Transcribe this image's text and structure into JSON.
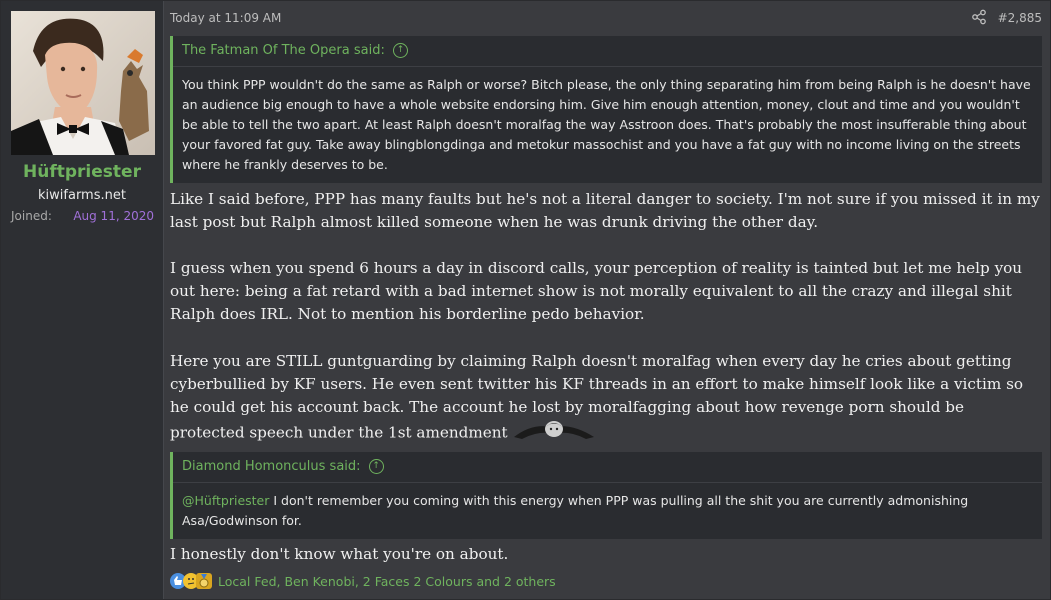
{
  "user": {
    "name": "Hüftpriester",
    "title": "kiwifarms.net",
    "joined_label": "Joined:",
    "joined_value": "Aug 11, 2020"
  },
  "post": {
    "timestamp": "Today at 11:09 AM",
    "number": "#2,885",
    "quote1": {
      "author": "The Fatman Of The Opera said:",
      "text": "You think PPP wouldn't do the same as Ralph or worse? Bitch please, the only thing separating him from being Ralph is he doesn't have an audience big enough to have a whole website endorsing him. Give him enough attention, money, clout and time and you wouldn't be able to tell the two apart. At least Ralph doesn't moralfag the way Asstroon does. That's probably the most insufferable thing about your favored fat guy. Take away blingblongdinga and metokur massochist and you have a fat guy with no income living on the streets where he frankly deserves to be."
    },
    "paragraph1": "Like I said before, PPP has many faults but he's not a literal danger to society. I'm not sure if you missed it in my last post but Ralph almost killed someone when he was drunk driving the other day.",
    "paragraph2": "I guess when you spend 6 hours a day in discord calls, your perception of reality is tainted but let me help you out here: being a fat retard with a bad internet show is not morally equivalent to all the crazy and illegal shit Ralph does IRL. Not to mention his borderline pedo behavior.",
    "paragraph3": "Here you are STILL guntguarding by claiming Ralph doesn't moralfag when every day he cries about getting cyberbullied by KF users. He even sent twitter his KF threads in an effort to make himself look like a victim so he could get his account back. The account he lost by moralfagging about how revenge porn should be protected speech under the 1st amendment",
    "quote2": {
      "author": "Diamond Homonculus said:",
      "mention": "@Hüftpriester",
      "text": " I don't remember you coming with this energy when PPP was pulling all the shit you are currently admonishing Asa/Godwinson for."
    },
    "paragraph4": "I honestly don't know what you're on about.",
    "reactions_text": "Local Fed, Ben Kenobi, 2 Faces 2 Colours and 2 others"
  },
  "icons": {
    "share": "share-icon",
    "quote_jump": "arrow-up-circle-icon",
    "reactions": [
      "thumbs-up-icon",
      "thinking-icon",
      "medal-icon"
    ]
  },
  "colors": {
    "accent": "#6fb35e",
    "joined_date": "#a070d8",
    "background": "#3a3b3f",
    "sidebar": "#2d2f33",
    "quote_bg": "#2a2c30"
  }
}
